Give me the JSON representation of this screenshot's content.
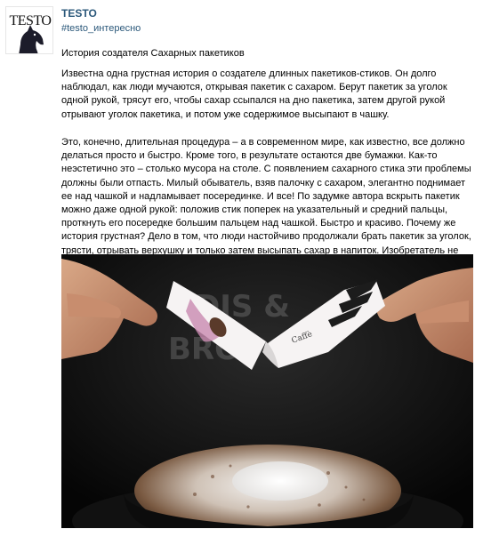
{
  "post": {
    "group_name": "TESTO",
    "hashtag": "#testo_интересно",
    "avatar_logo_text": "TESTO",
    "title": "История создателя Сахарных пакетиков",
    "paragraphs": [
      "Известна одна грустная история о создателе длинных пакетиков-стиков. Он долго наблюдал, как люди мучаются, открывая пакетик с сахаром. Берут пакетик за уголок одной рукой, трясут его, чтобы сахар ссыпался на дно пакетика, затем другой рукой отрывают уголок пакетика, и потом уже содержимое высыпают в чашку.",
      "Это, конечно, длительная процедура – а в современном мире, как известно, все должно делаться просто и быстро. Кроме того, в результате остаются две бумажки. Как-то неэстетично это – столько мусора на столе. С появлением сахарного стика эти проблемы должны были отпасть. Милый обыватель, взяв палочку с сахаром, элегантно поднимает ее над чашкой и надламывает посерединке. И все! По задумке автора вскрыть пакетик можно даже одной рукой: положив стик поперек на указательный и средний пальцы, проткнуть его посередке большим пальцем над чашкой. Быстро и красиво. Почему же история грустная? Дело в том, что люди настойчиво продолжали брать пакетик за уголок, трясти, отрывать верхушку и только затем высыпать сахар в напиток. Изобретатель не смог вынести такого издевательства над идеей и так расстроился, что сошел с ума и покончил жизнь самоубийством."
    ],
    "photo": {
      "sachet_brand": "Caffè",
      "icon": "photo-sugar-stick-over-cappuccino"
    }
  },
  "colors": {
    "link": "#2b587a",
    "text": "#000000",
    "photo_background": "#090909"
  }
}
